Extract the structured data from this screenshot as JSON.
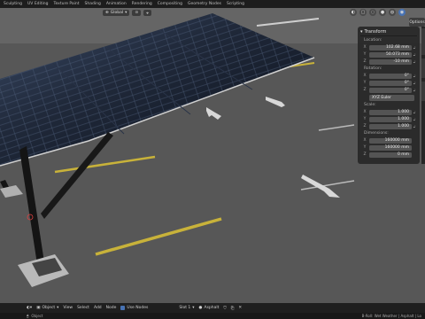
{
  "top_tabs": [
    "Sculpting",
    "UV Editing",
    "Texture Paint",
    "Shading",
    "Animation",
    "Rendering",
    "Compositing",
    "Geometry Nodes",
    "Scripting"
  ],
  "viewport_header": {
    "orientation": "Global",
    "options_label": "Options"
  },
  "npanel": {
    "title": "Transform",
    "location_label": "Location:",
    "location": [
      {
        "axis": "X",
        "value": "102.68 mm"
      },
      {
        "axis": "Y",
        "value": "50.073 mm"
      },
      {
        "axis": "Z",
        "value": "-10 mm"
      }
    ],
    "rotation_label": "Rotation:",
    "rotation": [
      {
        "axis": "X",
        "value": "0°"
      },
      {
        "axis": "Y",
        "value": "0°"
      },
      {
        "axis": "Z",
        "value": "0°"
      }
    ],
    "rotation_mode": "XYZ Euler",
    "scale_label": "Scale:",
    "scale": [
      {
        "axis": "X",
        "value": "1.000"
      },
      {
        "axis": "Y",
        "value": "1.000"
      },
      {
        "axis": "Z",
        "value": "1.000"
      }
    ],
    "dimensions_label": "Dimensions:",
    "dimensions": [
      {
        "axis": "X",
        "value": "160000 mm"
      },
      {
        "axis": "Y",
        "value": "160000 mm"
      },
      {
        "axis": "Z",
        "value": "0 mm"
      }
    ]
  },
  "bottom_bar": {
    "mode": "Object",
    "menus": [
      "View",
      "Select",
      "Add",
      "Node"
    ],
    "use_nodes": "Use Nodes",
    "slot": "Slot 1",
    "material": "Asphalt"
  },
  "status": {
    "left": "Object",
    "right": "B-Roll: Wet Weather | Asphalt | Lo"
  },
  "colors": {
    "accent": "#4772b3",
    "asphalt": "#5a5a5a",
    "line_yellow": "#c8b23a"
  }
}
